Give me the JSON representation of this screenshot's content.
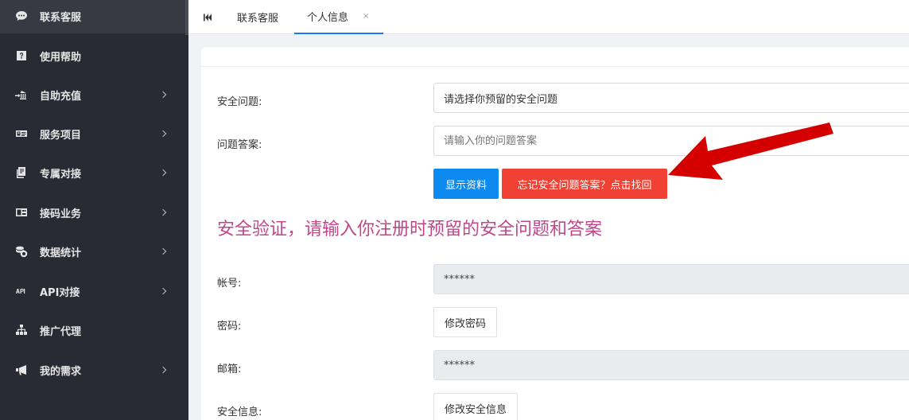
{
  "sidebar": {
    "items": [
      {
        "label": "联系客服",
        "icon": "chat-bubble-icon",
        "chevron": false,
        "active": true
      },
      {
        "label": "使用帮助",
        "icon": "question-icon",
        "chevron": false
      },
      {
        "label": "自助充值",
        "icon": "bank-transfer-icon",
        "chevron": true
      },
      {
        "label": "服务项目",
        "icon": "id-card-icon",
        "chevron": true
      },
      {
        "label": "专属对接",
        "icon": "document-copy-icon",
        "chevron": true
      },
      {
        "label": "接码业务",
        "icon": "sim-card-icon",
        "chevron": true
      },
      {
        "label": "数据统计",
        "icon": "coins-icon",
        "chevron": true
      },
      {
        "label": "API对接",
        "icon": "api-icon",
        "chevron": true
      },
      {
        "label": "推广代理",
        "icon": "sitemap-icon",
        "chevron": false
      },
      {
        "label": "我的需求",
        "icon": "megaphone-icon",
        "chevron": true
      }
    ]
  },
  "tabs": {
    "first_icon": "skip-back-icon",
    "items": [
      {
        "label": "联系客服"
      },
      {
        "label": "个人信息",
        "close": "×",
        "active": true
      }
    ]
  },
  "security_form": {
    "question_label": "安全问题:",
    "question_value": "请选择你预留的安全问题",
    "answer_label": "问题答案:",
    "answer_placeholder": "请输入你的问题答案",
    "show_button": "显示资料",
    "forgot_button": "忘记安全问题答案？点击找回",
    "notice": "安全验证，请输入你注册时预留的安全问题和答案"
  },
  "profile": {
    "account_label": "帐号:",
    "account_value": "******",
    "password_label": "密码:",
    "password_button": "修改密码",
    "email_label": "邮箱:",
    "email_value": "******",
    "security_label": "安全信息:",
    "security_button": "修改安全信息"
  },
  "colors": {
    "sidebar_bg": "#282b33",
    "primary_blue": "#0d8af0",
    "danger_red": "#f04134",
    "notice_pink": "#c0478a",
    "annotation_arrow": "#d40000"
  }
}
